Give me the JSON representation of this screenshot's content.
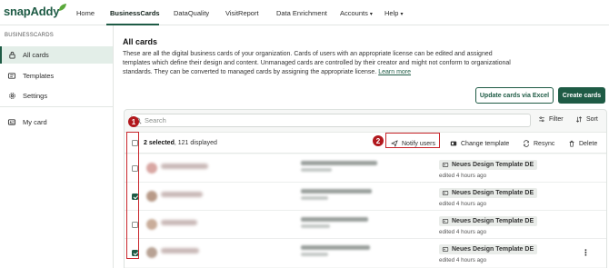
{
  "app": {
    "logo_text": "snapAddy"
  },
  "topnav": {
    "items": [
      {
        "label": "Home"
      },
      {
        "label": "BusinessCards"
      },
      {
        "label": "DataQuality"
      },
      {
        "label": "VisitReport"
      },
      {
        "label": "Data Enrichment"
      },
      {
        "label": "Accounts"
      },
      {
        "label": "Help"
      }
    ]
  },
  "sidebar": {
    "section": "BUSINESSCARDS",
    "items": [
      {
        "label": "All cards"
      },
      {
        "label": "Templates"
      },
      {
        "label": "Settings"
      },
      {
        "label": "My card"
      }
    ]
  },
  "main": {
    "title": "All cards",
    "description": "These are all the digital business cards of your organization. Cards of users with an appropriate license can be edited and assigned templates which define their design and content. Unmanaged cards are controlled by their creator and might not conform to organizational standards. They can be converted to managed cards by assigning the appropriate license.",
    "learn_more": "Learn more",
    "update_excel": "Update cards via Excel",
    "create_cards": "Create cards"
  },
  "toolbar": {
    "search_placeholder": "Search",
    "filter": "Filter",
    "sort": "Sort"
  },
  "actionbar": {
    "selected": "2 selected",
    "displayed": ", 121 displayed",
    "notify_users": "Notify users",
    "change_template": "Change template",
    "resync": "Resync",
    "delete": "Delete"
  },
  "rows": [
    {
      "checked": false,
      "template": "Neues Design Template DE",
      "edited": "edited 4 hours ago"
    },
    {
      "checked": true,
      "template": "Neues Design Template DE",
      "edited": "edited 4 hours ago"
    },
    {
      "checked": false,
      "template": "Neues Design Template DE",
      "edited": "edited 4 hours ago"
    },
    {
      "checked": true,
      "template": "Neues Design Template DE",
      "edited": "edited 4 hours ago"
    }
  ],
  "annotations": {
    "step1": "1",
    "step2": "2"
  },
  "colors": {
    "brand": "#1e5b45",
    "annotation_red": "#c8252b"
  }
}
